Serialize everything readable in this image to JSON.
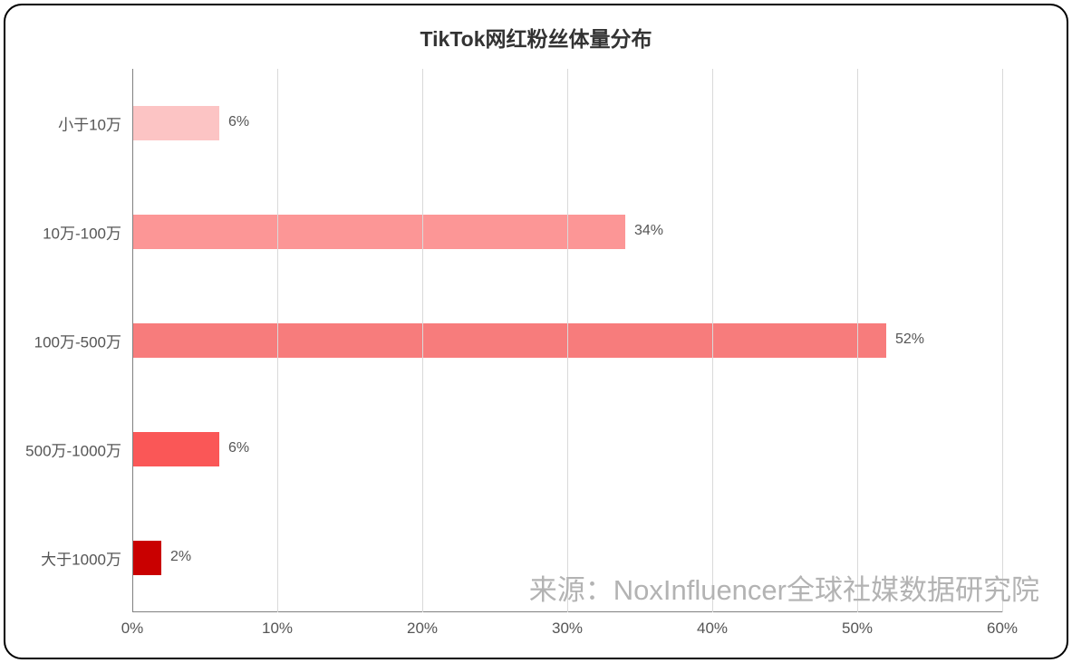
{
  "chart_data": {
    "type": "bar",
    "orientation": "horizontal",
    "title": "TikTok网红粉丝体量分布",
    "categories": [
      "小于10万",
      "10万-100万",
      "100万-500万",
      "500万-1000万",
      "大于1000万"
    ],
    "values": [
      6,
      34,
      52,
      6,
      2
    ],
    "value_labels": [
      "6%",
      "34%",
      "52%",
      "6%",
      "2%"
    ],
    "colors": [
      "#fcc4c4",
      "#fc9696",
      "#f77c7c",
      "#fa5757",
      "#c90000"
    ],
    "xlabel": "",
    "ylabel": "",
    "xlim": [
      0,
      60
    ],
    "x_ticks": [
      0,
      10,
      20,
      30,
      40,
      50,
      60
    ],
    "x_tick_labels": [
      "0%",
      "10%",
      "20%",
      "30%",
      "40%",
      "50%",
      "60%"
    ]
  },
  "watermark": "来源：NoxInfluencer全球社媒数据研究院"
}
